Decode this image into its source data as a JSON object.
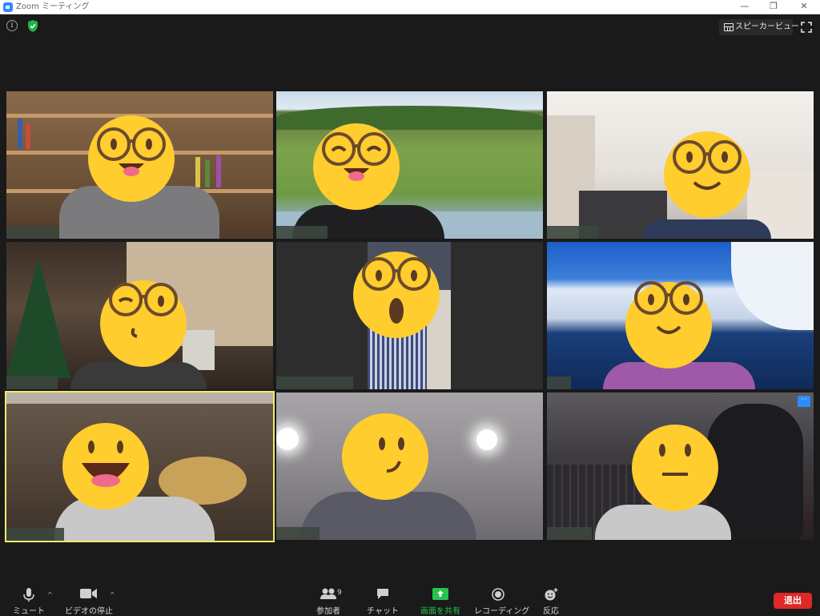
{
  "window": {
    "title": "Zoom ミーティング",
    "minimize_glyph": "—",
    "maximize_glyph": "❐",
    "close_glyph": "✕"
  },
  "top_bar": {
    "info_glyph": "i",
    "speaker_view_label": "スピーカービュー"
  },
  "gallery": {
    "tiles": [
      {
        "background": "bookshelf",
        "face": "tongue-smile",
        "active_speaker": false
      },
      {
        "background": "river-vineyard",
        "face": "tongue-smile",
        "active_speaker": false
      },
      {
        "background": "room",
        "face": "smile",
        "active_speaker": false
      },
      {
        "background": "christmas-room",
        "face": "wink",
        "active_speaker": false
      },
      {
        "background": "dark",
        "face": "surprised",
        "active_speaker": false
      },
      {
        "background": "snowy-lake",
        "face": "smile",
        "active_speaker": false
      },
      {
        "background": "house-interior",
        "face": "laughing",
        "active_speaker": true
      },
      {
        "background": "ceiling-lights",
        "face": "smirk",
        "active_speaker": false
      },
      {
        "background": "night-city-monster",
        "face": "neutral",
        "active_speaker": false
      }
    ],
    "highlight_color": "#f1ec6a",
    "more_button_glyph": "···"
  },
  "toolbar": {
    "mute_label": "ミュート",
    "video_label": "ビデオの停止",
    "participants_label": "参加者",
    "participants_count": "9",
    "chat_label": "チャット",
    "share_label": "画面を共有",
    "record_label": "レコーディング",
    "reactions_label": "反応",
    "leave_label": "退出",
    "caret_glyph": "^",
    "share_color": "#27c24c",
    "leave_color": "#e02828"
  }
}
